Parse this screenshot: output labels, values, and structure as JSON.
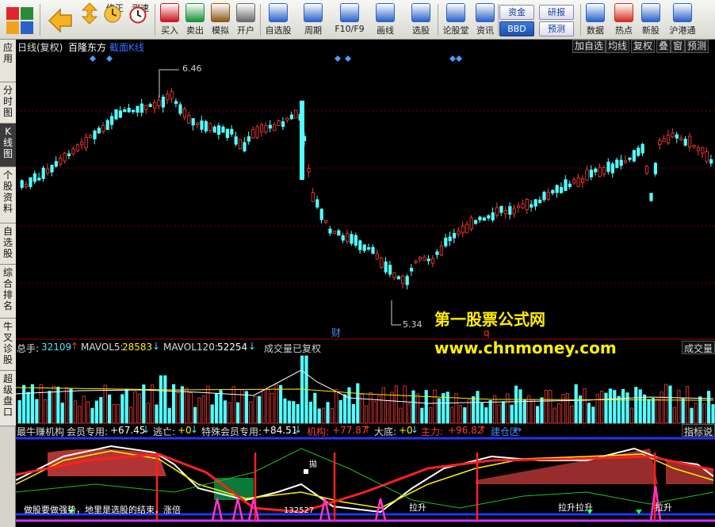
{
  "toolbar": {
    "buttons": [
      {
        "label": "买入",
        "icon": "buy-icon",
        "color": "#c8141e"
      },
      {
        "label": "卖出",
        "icon": "sell-icon",
        "color": "#16923a"
      },
      {
        "label": "模拟",
        "icon": "hammer-icon",
        "color": "#8a5a1a"
      },
      {
        "label": "开户",
        "icon": "lock-icon",
        "color": "#6a6a6a"
      },
      {
        "label": "自选股",
        "icon": "star-icon",
        "color": "#2a62c8"
      },
      {
        "label": "周期",
        "icon": "clock-icon",
        "color": "#2a62c8"
      },
      {
        "label": "F10/F9",
        "icon": "f10-icon",
        "color": "#2a62c8"
      },
      {
        "label": "画线",
        "icon": "pen-icon",
        "color": "#2a62c8"
      },
      {
        "label": "选股",
        "icon": "stock-screen-icon",
        "color": "#2a62c8"
      },
      {
        "label": "论股堂",
        "icon": "forum-icon",
        "color": "#2a62c8"
      },
      {
        "label": "资讯",
        "icon": "news-icon",
        "color": "#2a62c8"
      },
      {
        "label": "数据",
        "icon": "pe-icon",
        "color": "#2a62c8"
      },
      {
        "label": "热点",
        "icon": "hot-icon",
        "color": "#d2301e"
      },
      {
        "label": "新股",
        "icon": "ipo-icon",
        "color": "#2a62c8"
      },
      {
        "label": "沪港通",
        "icon": "hk-connect-icon",
        "color": "#2a62c8"
      }
    ],
    "nav": {
      "back_label": "",
      "fix_label": "修正",
      "speed_label": "测速"
    },
    "mini_buttons": {
      "funds": "资金",
      "bbd": "BBD",
      "research": "研报",
      "forecast": "预测"
    },
    "icon_texts": {
      "buy": "买",
      "sell": "卖",
      "forum": "论",
      "pe": "PE",
      "ipo": "IPO",
      "hk": "SSE HKE"
    }
  },
  "left_tabs": [
    {
      "label": "应用"
    },
    {
      "label": "分时图"
    },
    {
      "label": "K线图",
      "active": true
    },
    {
      "label": "个股资料"
    },
    {
      "label": "自选股"
    },
    {
      "label": "综合排名"
    },
    {
      "label": "牛叉诊股"
    },
    {
      "label": "超级盘口"
    }
  ],
  "header": {
    "period": "日线(复权)",
    "stock_name": "百隆东方",
    "mode": "截面K线",
    "right_buttons": [
      "加自选",
      "均线",
      "复权",
      "叠",
      "窗",
      "预测"
    ]
  },
  "price_chart": {
    "high_label": "6.46",
    "low_label": "5.34",
    "event_marker": "财",
    "event_marker2": "q"
  },
  "volume": {
    "total_label": "总手:",
    "total_value": "32109",
    "mavol5_label": "MAVOL5:",
    "mavol5_value": "28583",
    "mavol120_label": "MAVOL120:",
    "mavol120_value": "52254",
    "restored_label": "成交量已复权",
    "right_tag": "成交量"
  },
  "indicator": {
    "name": "最牛赚机构",
    "member_label": "会员专用:",
    "member_value": "+67.45",
    "escape_label": "逃亡:",
    "escape_value": "+0",
    "special_label": "特殊会员专用:",
    "special_value": "+84.51",
    "inst_label": "机构:",
    "inst_value": "+77.87",
    "bottom_label": "大底:",
    "bottom_value": "+0",
    "main_label": "主力:",
    "main_value": "+96.82",
    "zone_label": "建仓区",
    "right_tag": "指标说",
    "texts": {
      "raise1": "拉升",
      "raise2": "拉升",
      "raise3": "拉升拉升",
      "raise4": "拉升",
      "left_line": "做股要做强势，地里是选股的结束，涨倍",
      "mid_line": "132527",
      "small_ring": "拋"
    }
  },
  "watermark": {
    "title": "第一股票公式网",
    "url": "www.chnmoney.com"
  },
  "colors": {
    "up": "#ff3b3b",
    "down": "#54ffff",
    "bear_area": "#b03434",
    "bull_area": "#0a7a3a",
    "highlight": "#ffee00"
  }
}
